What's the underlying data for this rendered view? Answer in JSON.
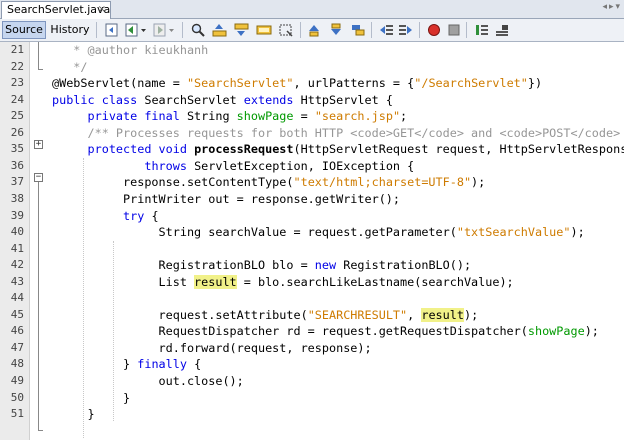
{
  "tab": {
    "title": "SearchServlet.java",
    "close": "×",
    "nav": "◂▸▾"
  },
  "toolbar": {
    "source_label": "Source",
    "history_label": "History",
    "icons": [
      "last-edit-icon",
      "back-icon",
      "forward-icon",
      "find-icon",
      "find-previous-icon",
      "find-next-icon",
      "find-selection-icon",
      "toggle-highlight-icon",
      "toggle-rect-selection-icon",
      "previous-bookmark-icon",
      "next-bookmark-icon",
      "toggle-bookmark-icon",
      "shift-left-icon",
      "shift-right-icon",
      "start-macro-icon",
      "stop-macro-icon",
      "comment-icon",
      "uncomment-icon"
    ]
  },
  "colors": {
    "keyword": "#0000e6",
    "string": "#ce7b00",
    "comment": "#969696",
    "field": "#009900",
    "highlight": "#f1f189",
    "gutter": "#ebebeb"
  },
  "lines": [
    {
      "num": "21",
      "tokens": [
        {
          "t": "   * @author kieukhanh",
          "c": "com"
        }
      ]
    },
    {
      "num": "22",
      "tokens": [
        {
          "t": "   */",
          "c": "com"
        }
      ]
    },
    {
      "num": "23",
      "tokens": [
        {
          "t": "@WebServlet(name = "
        },
        {
          "t": "\"SearchServlet\"",
          "c": "str"
        },
        {
          "t": ", urlPatterns = {"
        },
        {
          "t": "\"/SearchServlet\"",
          "c": "str"
        },
        {
          "t": "})"
        }
      ]
    },
    {
      "num": "24",
      "tokens": [
        {
          "t": "public class ",
          "c": "kw"
        },
        {
          "t": "SearchServlet "
        },
        {
          "t": "extends ",
          "c": "kw"
        },
        {
          "t": "HttpServlet {"
        }
      ]
    },
    {
      "num": "25",
      "tokens": [
        {
          "t": "     "
        },
        {
          "t": "private final ",
          "c": "kw"
        },
        {
          "t": "String "
        },
        {
          "t": "showPage",
          "c": "fld"
        },
        {
          "t": " = "
        },
        {
          "t": "\"search.jsp\"",
          "c": "str"
        },
        {
          "t": ";"
        }
      ]
    },
    {
      "num": "26",
      "tokens": [
        {
          "t": "     "
        },
        {
          "t": "/** Processes requests for both HTTP <code>GET</code> and <code>POST</code>",
          "c": "com"
        }
      ]
    },
    {
      "num": "35",
      "tokens": [
        {
          "t": "     "
        },
        {
          "t": "protected void ",
          "c": "kw"
        },
        {
          "t": "processRequest",
          "c": "b"
        },
        {
          "t": "(HttpServletRequest request, HttpServletResponse response)"
        }
      ]
    },
    {
      "num": "36",
      "tokens": [
        {
          "t": "             "
        },
        {
          "t": "throws ",
          "c": "kw"
        },
        {
          "t": "ServletException, IOException {"
        }
      ]
    },
    {
      "num": "37",
      "tokens": [
        {
          "t": "          response.setContentType("
        },
        {
          "t": "\"text/html;charset=UTF-8\"",
          "c": "str"
        },
        {
          "t": ");"
        }
      ]
    },
    {
      "num": "38",
      "tokens": [
        {
          "t": "          PrintWriter out = response.getWriter();"
        }
      ]
    },
    {
      "num": "39",
      "tokens": [
        {
          "t": "          "
        },
        {
          "t": "try ",
          "c": "kw"
        },
        {
          "t": "{"
        }
      ]
    },
    {
      "num": "40",
      "tokens": [
        {
          "t": "               String searchValue = request.getParameter("
        },
        {
          "t": "\"txtSearchValue\"",
          "c": "str"
        },
        {
          "t": ");"
        }
      ]
    },
    {
      "num": "41",
      "tokens": [
        {
          "t": ""
        }
      ]
    },
    {
      "num": "42",
      "tokens": [
        {
          "t": "               RegistrationBLO blo = "
        },
        {
          "t": "new ",
          "c": "kw"
        },
        {
          "t": "RegistrationBLO();"
        }
      ]
    },
    {
      "num": "43",
      "tokens": [
        {
          "t": "               List "
        },
        {
          "t": "result",
          "c": "hl"
        },
        {
          "t": " = blo.searchLikeLastname(searchValue);"
        }
      ]
    },
    {
      "num": "44",
      "tokens": [
        {
          "t": ""
        }
      ]
    },
    {
      "num": "45",
      "tokens": [
        {
          "t": "               request.setAttribute("
        },
        {
          "t": "\"SEARCHRESULT\"",
          "c": "str"
        },
        {
          "t": ", "
        },
        {
          "t": "result",
          "c": "hl"
        },
        {
          "t": ");"
        }
      ]
    },
    {
      "num": "46",
      "tokens": [
        {
          "t": "               RequestDispatcher rd = request.getRequestDispatcher("
        },
        {
          "t": "showPage",
          "c": "fld"
        },
        {
          "t": ");"
        }
      ]
    },
    {
      "num": "47",
      "tokens": [
        {
          "t": "               rd.forward(request, response);"
        }
      ]
    },
    {
      "num": "48",
      "tokens": [
        {
          "t": "          } "
        },
        {
          "t": "finally ",
          "c": "kw"
        },
        {
          "t": "{"
        }
      ]
    },
    {
      "num": "49",
      "tokens": [
        {
          "t": "               out.close();"
        }
      ]
    },
    {
      "num": "50",
      "tokens": [
        {
          "t": "          }"
        }
      ]
    },
    {
      "num": "51",
      "tokens": [
        {
          "t": "     }"
        }
      ]
    }
  ]
}
